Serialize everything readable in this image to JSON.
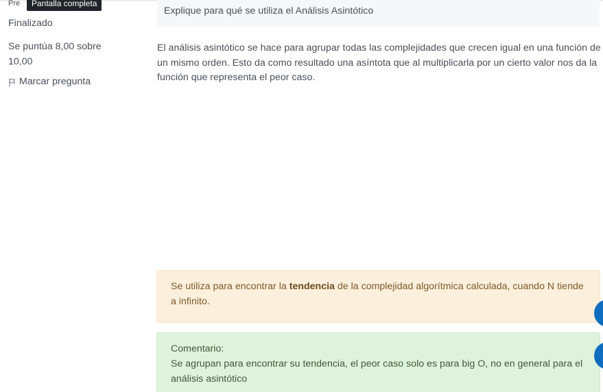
{
  "info": {
    "question_number": "Pre",
    "tooltip": "Pantalla completa",
    "state": "Finalizado",
    "grade": "Se puntúa 8,00 sobre 10,00",
    "flag_label": "Marcar pregunta",
    "flag_icon": "flag-icon"
  },
  "question": {
    "text": "Explique para qué se utiliza el Análisis Asintótico"
  },
  "answer": {
    "text": "El análisis asintótico se hace para agrupar todas las complejidades que crecen igual en una función de un mismo orden. Esto da como resultado una asíntota que al multiplicarla por un cierto valor nos da la función que representa el peor caso."
  },
  "feedback": {
    "before": "Se utiliza para encontrar la ",
    "bold": "tendencia",
    "after": " de la complejidad algorítmica calculada, cuando N tiende a infinito."
  },
  "comment": {
    "label": "Comentario:",
    "text": "Se agrupan para encontrar su tendencia, el peor caso solo es para big O, no en general para el análisis asintótico"
  },
  "colors": {
    "primary": "#0f6cbf",
    "feedback_bg": "#fcefdc",
    "comment_bg": "#def2dc",
    "question_bg": "#f5f8fb",
    "tooltip_bg": "#212529"
  }
}
